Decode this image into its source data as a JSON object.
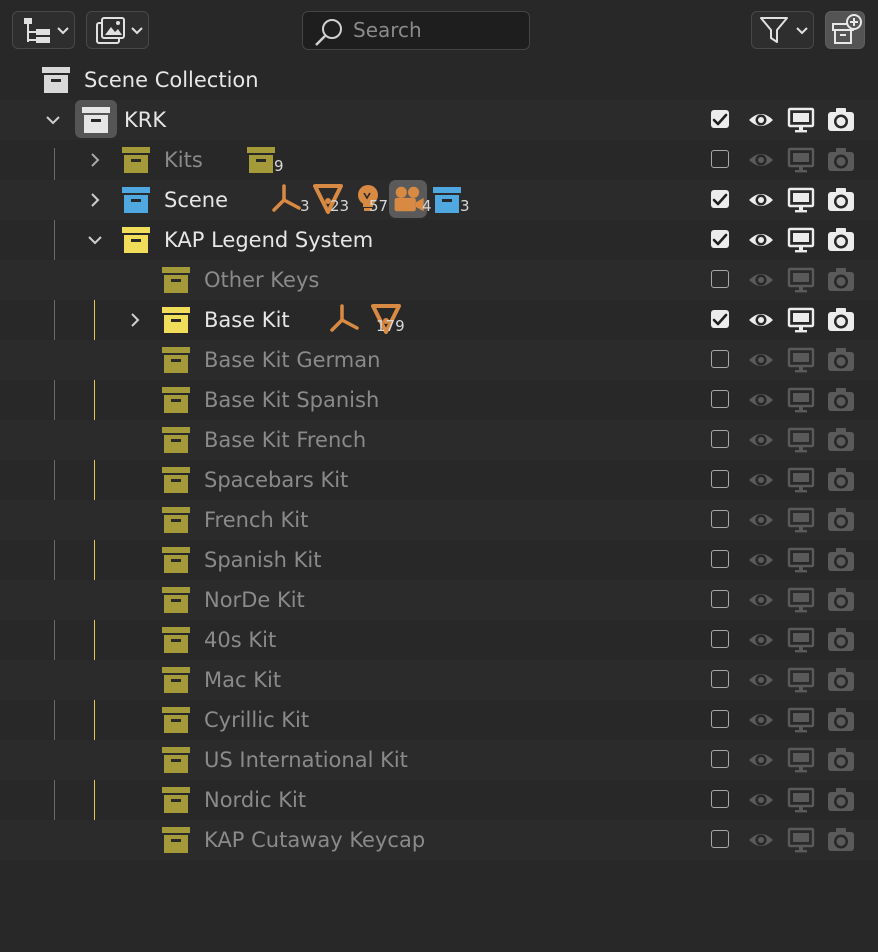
{
  "header": {
    "display_mode_icon": "outliner-icon",
    "view_layer_icon": "image-layers-icon",
    "search_placeholder": "Search",
    "filter_icon": "filter-icon",
    "new_collection_icon": "new-collection-icon"
  },
  "colors": {
    "collection_white": "#d8d8d8",
    "collection_olive": "#a49a3a",
    "collection_blue": "#4fa8e0",
    "collection_yellow": "#f0de5a",
    "object_orange": "#d98a42",
    "hierarchy_line_yellow": "#e0c850"
  },
  "tree": {
    "scene_collection": {
      "label": "Scene Collection"
    },
    "krk": {
      "label": "KRK",
      "expanded": true,
      "checked": true
    },
    "kits": {
      "label": "Kits",
      "expanded": false,
      "checked": false,
      "badges": {
        "collections": "9"
      }
    },
    "scene": {
      "label": "Scene",
      "expanded": false,
      "checked": true,
      "badges": {
        "empties": "3",
        "meshes": "23",
        "lights": "57",
        "cameras": "4",
        "collections": "3"
      }
    },
    "kap_legend_system": {
      "label": "KAP Legend System",
      "expanded": true,
      "checked": true
    },
    "children": [
      {
        "label": "Other Keys",
        "checked": false
      },
      {
        "label": "Base Kit",
        "checked": true,
        "badges": {
          "meshes": "179"
        }
      },
      {
        "label": "Base Kit German",
        "checked": false
      },
      {
        "label": "Base Kit Spanish",
        "checked": false
      },
      {
        "label": "Base Kit French",
        "checked": false
      },
      {
        "label": "Spacebars Kit",
        "checked": false
      },
      {
        "label": "French Kit",
        "checked": false
      },
      {
        "label": "Spanish Kit",
        "checked": false
      },
      {
        "label": "NorDe Kit",
        "checked": false
      },
      {
        "label": "40s Kit",
        "checked": false
      },
      {
        "label": "Mac Kit",
        "checked": false
      },
      {
        "label": "Cyrillic Kit",
        "checked": false
      },
      {
        "label": "US International Kit",
        "checked": false
      },
      {
        "label": "Nordic Kit",
        "checked": false
      },
      {
        "label": "KAP Cutaway Keycap",
        "checked": false
      }
    ]
  }
}
